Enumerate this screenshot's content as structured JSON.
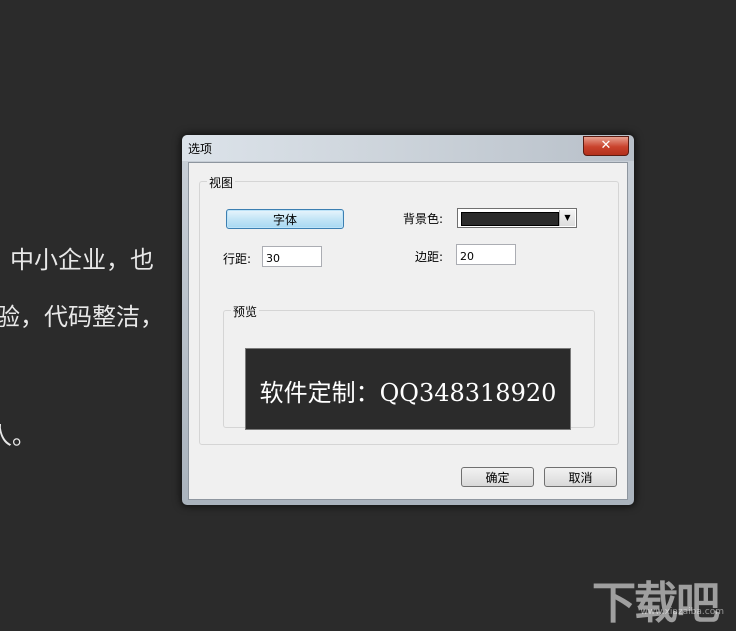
{
  "background": {
    "lines": [
      "中小企业，也",
      "验，代码整洁，",
      "人。"
    ]
  },
  "watermark": {
    "text": "下载吧",
    "url": "www.xiazaiba.com"
  },
  "dialog": {
    "title": "选项",
    "close_glyph": "✕",
    "view_group_label": "视图",
    "font_button": "字体",
    "background_color_label": "背景色:",
    "background_color_value": "#2b2b2b",
    "line_spacing_label": "行距:",
    "line_spacing_value": "30",
    "margin_label": "边距:",
    "margin_value": "20",
    "preview_group_label": "预览",
    "preview_text": "软件定制：QQ348318920",
    "ok_button": "确定",
    "cancel_button": "取消"
  },
  "icons": {
    "close": "close-icon",
    "dropdown": "chevron-down-icon"
  }
}
